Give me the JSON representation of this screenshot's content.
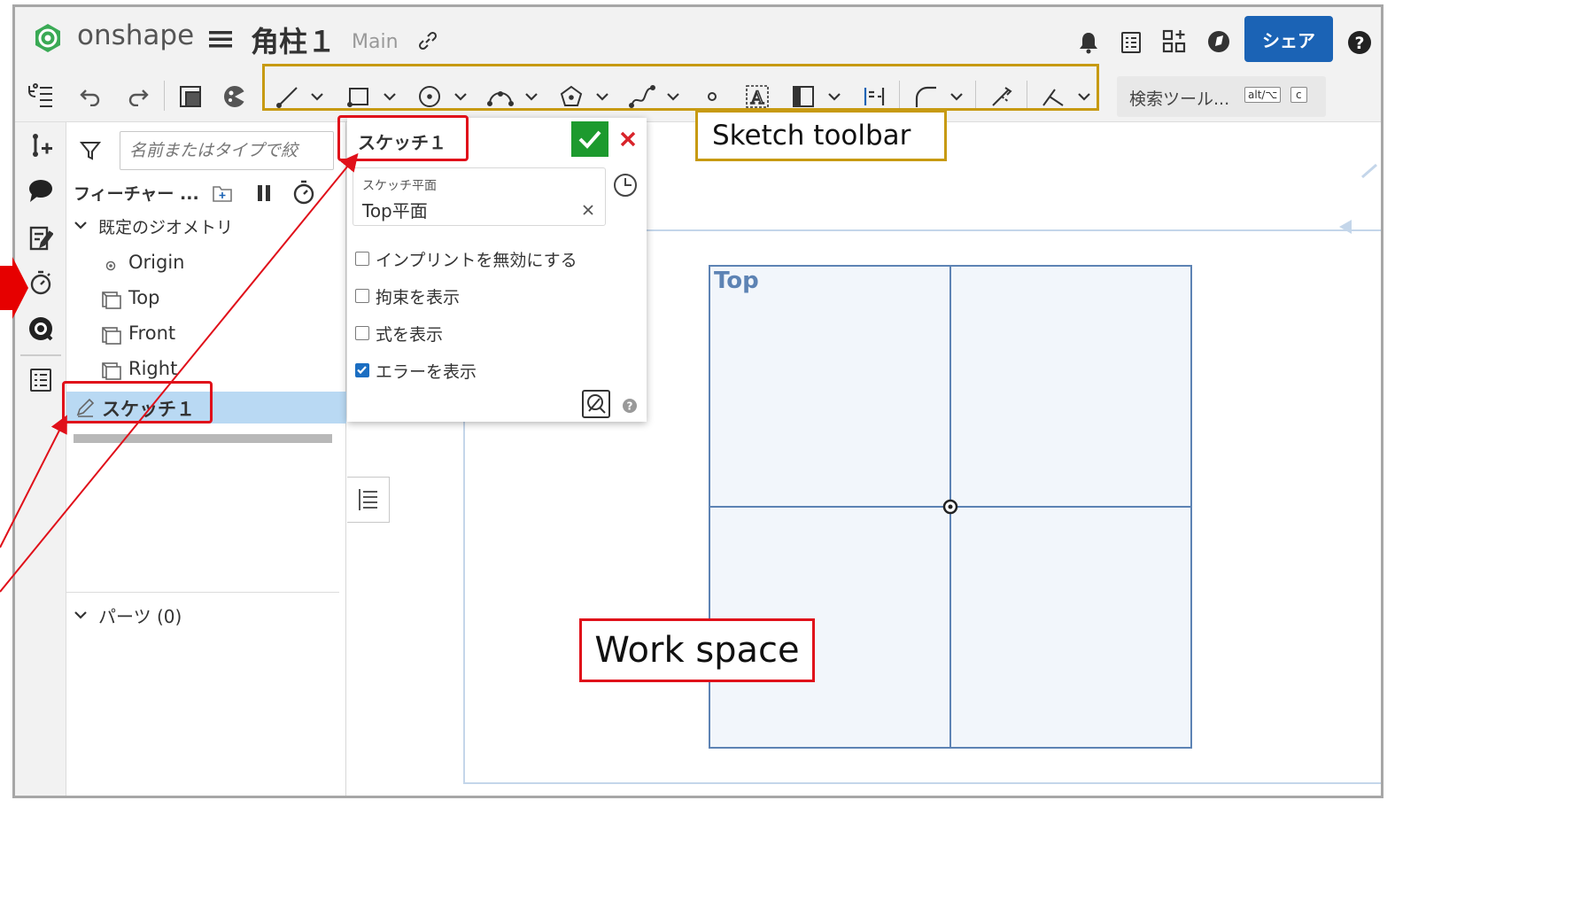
{
  "app": {
    "brand": "onshape",
    "doc_title": "角柱１",
    "branch": "Main",
    "share_label": "シェア"
  },
  "toolbar": {
    "search_label": "検索ツール...",
    "shortcut_alt": "alt/⌥",
    "shortcut_key": "c"
  },
  "feature_panel": {
    "filter_placeholder": "名前またはタイプで絞",
    "features_label": "フィーチャー ...",
    "default_geometry_label": "既定のジオメトリ",
    "items": [
      {
        "label": "Origin"
      },
      {
        "label": "Top"
      },
      {
        "label": "Front"
      },
      {
        "label": "Right"
      }
    ],
    "sketch_item": "スケッチ１",
    "parts_label": "パーツ (0)"
  },
  "sketch_dialog": {
    "title": "スケッチ１",
    "plane_caption": "スケッチ平面",
    "plane_value": "Top平面",
    "options": [
      {
        "label": "インプリントを無効にする",
        "checked": false
      },
      {
        "label": "拘束を表示",
        "checked": false
      },
      {
        "label": "式を表示",
        "checked": false
      },
      {
        "label": "エラーを表示",
        "checked": true
      }
    ]
  },
  "viewport": {
    "plane_label": "Top"
  },
  "annotations": {
    "sketch_toolbar": "Sketch toolbar",
    "work_space": "Work space"
  },
  "colors": {
    "accent": "#1b63b5",
    "confirm": "#1d9a2e",
    "cancel": "#d8232a",
    "annotation_red": "#e0101a",
    "annotation_gold": "#c79a12",
    "plane_line": "#5d83b4",
    "plane_fill": "#f2f6fb"
  }
}
